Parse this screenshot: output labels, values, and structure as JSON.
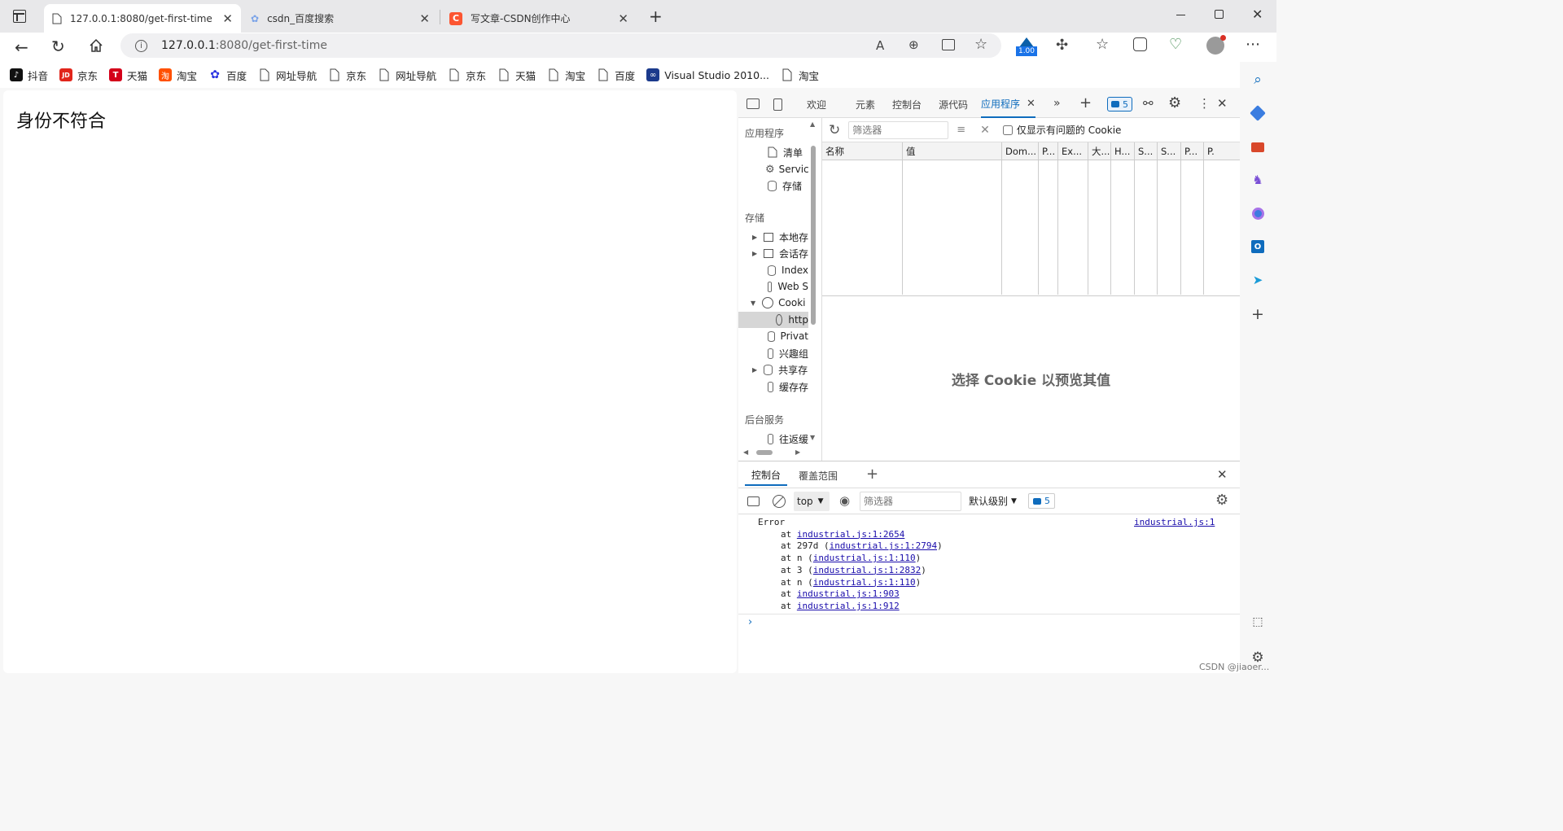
{
  "tabs": [
    {
      "title": "127.0.0.1:8080/get-first-time",
      "icon": "page-icon"
    },
    {
      "title": "csdn_百度搜索",
      "icon": "baidu-paw-icon"
    },
    {
      "title": "写文章-CSDN创作中心",
      "icon": "csdn-icon"
    }
  ],
  "address": {
    "host": "127.0.0.1",
    "path": ":8080/get-first-time"
  },
  "extension_badge": "1.00",
  "bookmarks": [
    {
      "label": "抖音",
      "icon": "douyin-icon"
    },
    {
      "label": "京东",
      "icon": "jd-icon",
      "icon_text": "JD"
    },
    {
      "label": "天猫",
      "icon": "tmall-icon",
      "icon_text": "T"
    },
    {
      "label": "淘宝",
      "icon": "taobao-icon",
      "icon_text": "淘"
    },
    {
      "label": "百度",
      "icon": "baidu-icon"
    },
    {
      "label": "网址导航",
      "icon": "page-icon"
    },
    {
      "label": "京东",
      "icon": "page-icon"
    },
    {
      "label": "网址导航",
      "icon": "page-icon"
    },
    {
      "label": "京东",
      "icon": "page-icon"
    },
    {
      "label": "天猫",
      "icon": "page-icon"
    },
    {
      "label": "淘宝",
      "icon": "page-icon"
    },
    {
      "label": "百度",
      "icon": "page-icon"
    },
    {
      "label": "Visual Studio 2010...",
      "icon": "vs-icon"
    },
    {
      "label": "淘宝",
      "icon": "page-icon"
    }
  ],
  "page": {
    "heading": "身份不符合"
  },
  "devtools": {
    "tabs": [
      "欢迎",
      "元素",
      "控制台",
      "源代码",
      "应用程序"
    ],
    "issues_count": "5",
    "sidebar": {
      "section_app": "应用程序",
      "app_items": [
        "清单",
        "Servic",
        "存储"
      ],
      "section_storage": "存储",
      "storage_items": [
        "本地存",
        "会话存",
        "Index",
        "Web S",
        "Cooki",
        "http",
        "Privat",
        "兴趣组",
        "共享存",
        "缓存存"
      ],
      "section_bg": "后台服务",
      "bg_items": [
        "往返缓"
      ]
    },
    "filter_placeholder": "筛选器",
    "only_issues_label": "仅显示有问题的 Cookie",
    "columns": [
      "名称",
      "值",
      "Dom...",
      "P...",
      "Ex...",
      "大...",
      "H...",
      "S...",
      "S...",
      "P...",
      "P."
    ],
    "preview_text": "选择 Cookie 以预览其值",
    "drawer": {
      "tabs": [
        "控制台",
        "覆盖范围"
      ],
      "context": "top",
      "filter_placeholder": "筛选器",
      "level": "默认级别",
      "issues": "5",
      "error_title": "Error",
      "error_source": "industrial.js:1",
      "stack": [
        {
          "pre": "at ",
          "link": "industrial.js:1:2654",
          "post": ""
        },
        {
          "pre": "at 297d (",
          "link": "industrial.js:1:2794",
          "post": ")"
        },
        {
          "pre": "at n (",
          "link": "industrial.js:1:110",
          "post": ")"
        },
        {
          "pre": "at 3 (",
          "link": "industrial.js:1:2832",
          "post": ")"
        },
        {
          "pre": "at n (",
          "link": "industrial.js:1:110",
          "post": ")"
        },
        {
          "pre": "at ",
          "link": "industrial.js:1:903",
          "post": ""
        },
        {
          "pre": "at ",
          "link": "industrial.js:1:912",
          "post": ""
        }
      ]
    }
  },
  "watermark": "CSDN @jiaoer...",
  "colors": {
    "accent": "#0f6cbd",
    "csdn": "#fc5531",
    "jd": "#e1251b",
    "tmall": "#d4001a",
    "taobao": "#ff5000",
    "baidu": "#2932e1"
  }
}
